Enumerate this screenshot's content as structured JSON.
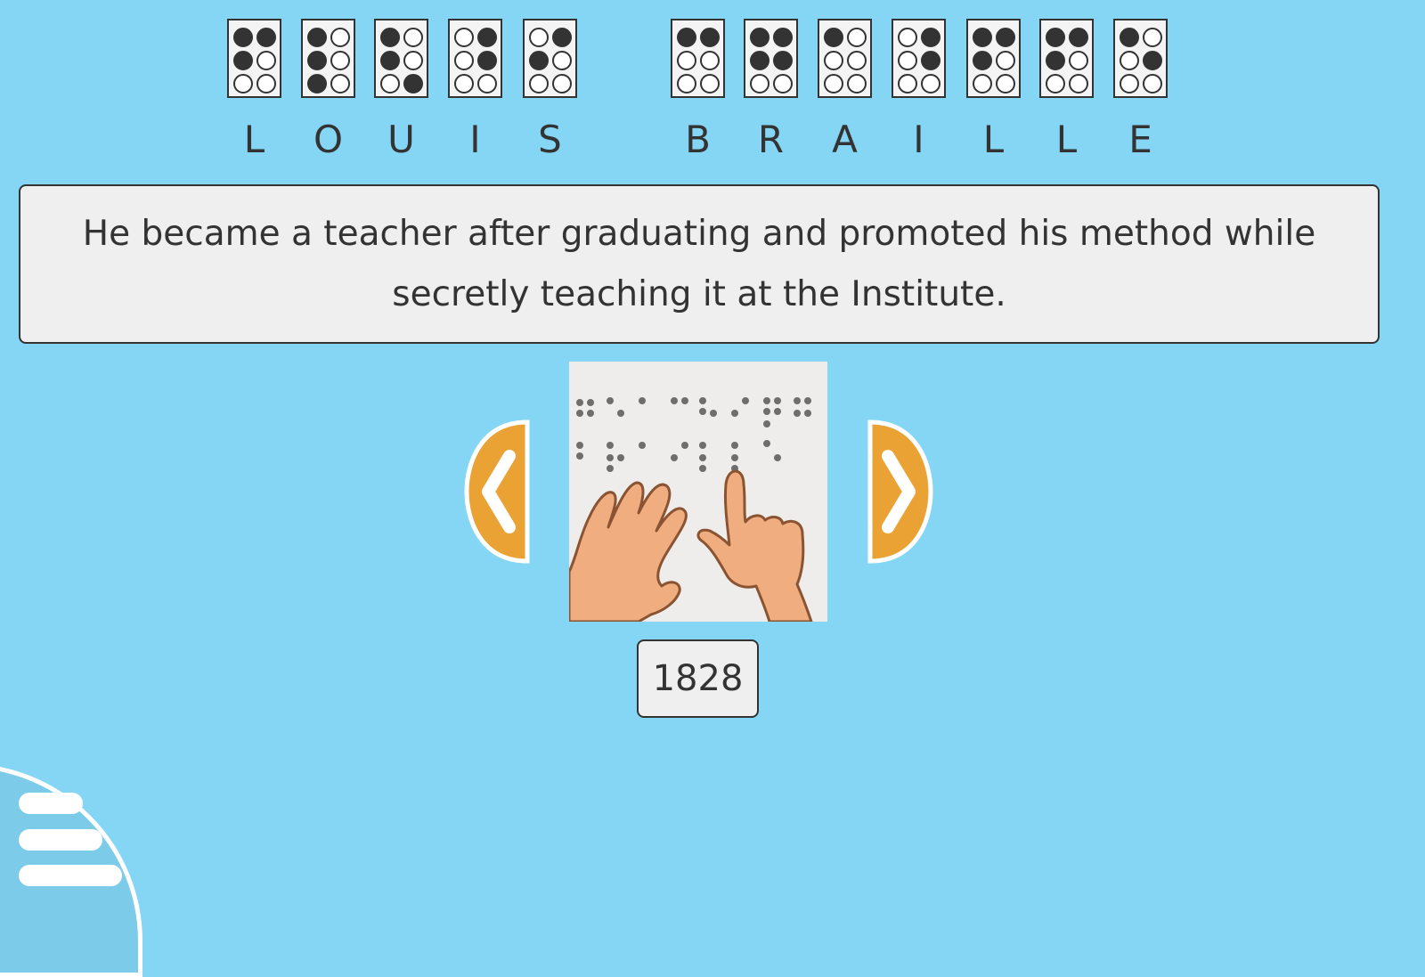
{
  "name_heading": {
    "letters": [
      "L",
      "O",
      "U",
      "I",
      "S",
      "B",
      "R",
      "A",
      "I",
      "L",
      "L",
      "E"
    ],
    "cells": [
      [
        1,
        1,
        1,
        0,
        0,
        0
      ],
      [
        1,
        0,
        1,
        0,
        1,
        0
      ],
      [
        1,
        0,
        1,
        0,
        0,
        1
      ],
      [
        0,
        1,
        0,
        1,
        0,
        0
      ],
      [
        0,
        1,
        1,
        0,
        0,
        0
      ],
      [
        1,
        1,
        0,
        0,
        0,
        0
      ],
      [
        1,
        1,
        1,
        1,
        0,
        0
      ],
      [
        1,
        0,
        0,
        0,
        0,
        0
      ],
      [
        0,
        1,
        0,
        1,
        0,
        0
      ],
      [
        1,
        1,
        1,
        0,
        0,
        0
      ],
      [
        1,
        1,
        1,
        0,
        0,
        0
      ],
      [
        1,
        0,
        0,
        1,
        0,
        0
      ]
    ]
  },
  "fact": {
    "text": "He became a teacher after graduating and promoted his method while secretly teaching it at the Institute."
  },
  "illustration": {
    "icon": "hands-reading-braille-icon"
  },
  "navigation": {
    "prev_icon": "chevron-left-icon",
    "next_icon": "chevron-right-icon"
  },
  "year": {
    "value": "1828"
  },
  "menu": {
    "icon": "hamburger-menu-icon"
  },
  "colors": {
    "background": "#84d6f4",
    "arrow_fill": "#e9a233",
    "dot_fill": "#333333"
  }
}
